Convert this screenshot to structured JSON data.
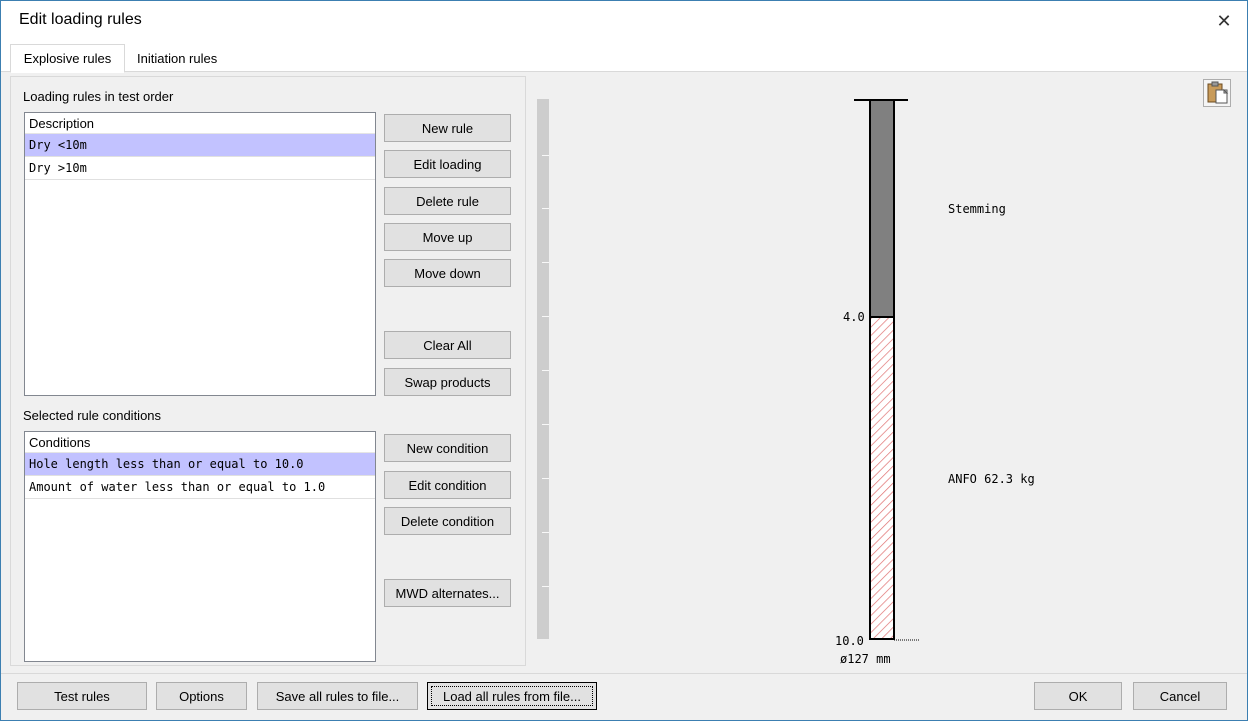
{
  "window": {
    "title": "Edit loading rules"
  },
  "tabs": [
    {
      "label": "Explosive rules",
      "active": true
    },
    {
      "label": "Initiation rules",
      "active": false
    }
  ],
  "rules_section": {
    "label": "Loading rules in test order",
    "header": "Description",
    "rows": [
      "Dry <10m",
      "Dry >10m"
    ],
    "selected_index": 0
  },
  "rule_buttons": {
    "new_rule": "New rule",
    "edit_loading": "Edit loading",
    "delete_rule": "Delete rule",
    "move_up": "Move up",
    "move_down": "Move down",
    "clear_all": "Clear All",
    "swap_products": "Swap products"
  },
  "conditions_section": {
    "label": "Selected rule conditions",
    "header": "Conditions",
    "rows": [
      "Hole length less than or equal to 10.0",
      "Amount of water less than or equal to 1.0"
    ],
    "selected_index": 0
  },
  "condition_buttons": {
    "new_condition": "New condition",
    "edit_condition": "Edit condition",
    "delete_condition": "Delete condition",
    "mwd_alternates": "MWD alternates..."
  },
  "hole_chart": {
    "stemming_label": "Stemming",
    "product_label": "ANFO 62.3 kg",
    "depth_change": "4.0",
    "depth_bottom": "10.0",
    "diameter_label": "ø127 mm",
    "stemming_color": "#808080",
    "product_hatch_color": "#e07070"
  },
  "bottom_buttons": {
    "test_rules": "Test rules",
    "options": "Options",
    "save_all": "Save all rules to file...",
    "load_all": "Load all rules from file...",
    "ok": "OK",
    "cancel": "Cancel"
  },
  "icons": {
    "close": "close-icon",
    "clipboard": "clipboard-icon"
  }
}
